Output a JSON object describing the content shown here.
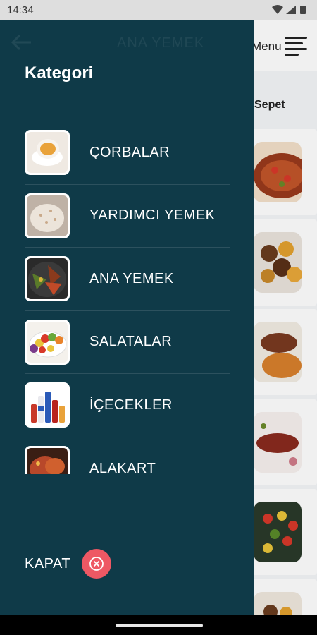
{
  "status_bar": {
    "time": "14:34",
    "icons": [
      "wifi-icon",
      "signal-icon",
      "battery-icon"
    ]
  },
  "background_app": {
    "title": "ANA YEMEK",
    "menu_label": "Menu",
    "cart_label": "Sepet"
  },
  "drawer": {
    "title": "Kategori",
    "categories": [
      {
        "label": "ÇORBALAR",
        "icon": "soup-thumbnail"
      },
      {
        "label": "YARDIMCI YEMEK",
        "icon": "rice-thumbnail"
      },
      {
        "label": "ANA YEMEK",
        "icon": "main-dish-thumbnail"
      },
      {
        "label": "SALATALAR",
        "icon": "salad-thumbnail"
      },
      {
        "label": "İÇECEKLER",
        "icon": "drinks-thumbnail"
      },
      {
        "label": "ALAKART",
        "icon": "alakart-thumbnail"
      }
    ],
    "close_label": "KAPAT"
  },
  "colors": {
    "drawer_bg": "#0f3a48",
    "close_button": "#ee5864",
    "text": "#ffffff"
  }
}
